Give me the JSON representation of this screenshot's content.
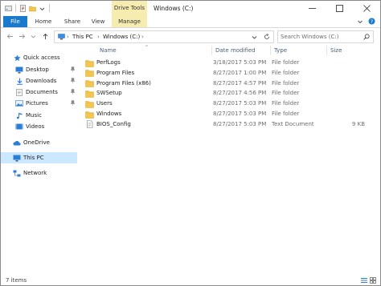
{
  "window": {
    "title": "Windows (C:)",
    "context_tab": "Drive Tools"
  },
  "ribbon": {
    "tabs": [
      "File",
      "Home",
      "Share",
      "View",
      "Manage"
    ]
  },
  "address": {
    "crumbs": [
      "This PC",
      "Windows (C:)"
    ],
    "search_placeholder": "Search Windows (C:)"
  },
  "nav": {
    "quick_access": "Quick access",
    "pinned": [
      "Desktop",
      "Downloads",
      "Documents",
      "Pictures"
    ],
    "other": [
      "Music",
      "Videos"
    ],
    "onedrive": "OneDrive",
    "this_pc": "This PC",
    "network": "Network"
  },
  "columns": {
    "name": "Name",
    "date": "Date modified",
    "type": "Type",
    "size": "Size"
  },
  "files": [
    {
      "name": "PerfLogs",
      "date": "3/18/2017 5:03 PM",
      "type": "File folder",
      "size": "",
      "kind": "folder"
    },
    {
      "name": "Program Files",
      "date": "8/27/2017 1:00 PM",
      "type": "File folder",
      "size": "",
      "kind": "folder"
    },
    {
      "name": "Program Files (x86)",
      "date": "8/27/2017 4:57 PM",
      "type": "File folder",
      "size": "",
      "kind": "folder"
    },
    {
      "name": "SWSetup",
      "date": "8/27/2017 4:56 PM",
      "type": "File folder",
      "size": "",
      "kind": "folder"
    },
    {
      "name": "Users",
      "date": "8/27/2017 5:03 PM",
      "type": "File folder",
      "size": "",
      "kind": "folder"
    },
    {
      "name": "Windows",
      "date": "8/27/2017 5:03 PM",
      "type": "File folder",
      "size": "",
      "kind": "folder"
    },
    {
      "name": "BIOS_Config",
      "date": "8/27/2017 5:03 PM",
      "type": "Text Document",
      "size": "9 KB",
      "kind": "text"
    }
  ],
  "status": {
    "item_count": "7 items"
  },
  "colors": {
    "file_tab": "#1979ca",
    "manage_tab": "#f6ecb0",
    "selection": "#cce8ff",
    "folder": "#f3c74f"
  }
}
